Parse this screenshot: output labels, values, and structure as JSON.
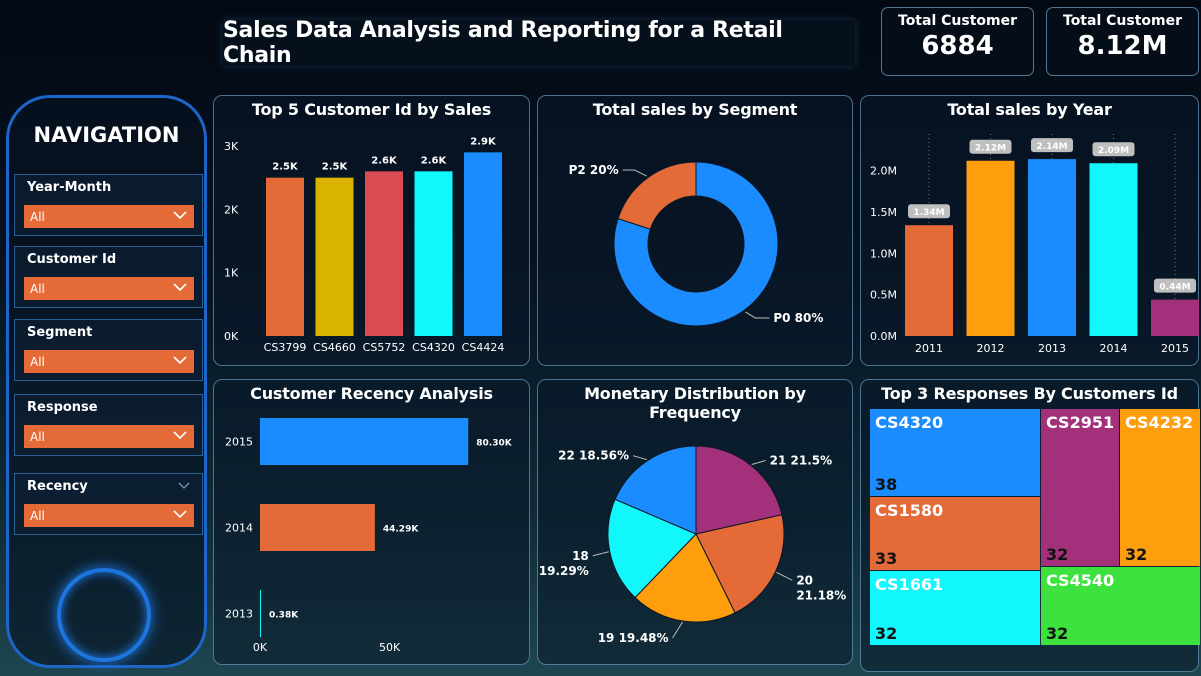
{
  "header": {
    "title": "Sales Data Analysis and Reporting for a Retail Chain"
  },
  "kpis": [
    {
      "label": "Total Customer",
      "value": "6884"
    },
    {
      "label": "Total Customer",
      "value": "8.12M"
    }
  ],
  "nav": {
    "title": "NAVIGATION",
    "filters": [
      {
        "label": "Year-Month",
        "value": "All"
      },
      {
        "label": "Customer Id",
        "value": "All"
      },
      {
        "label": "Segment",
        "value": "All"
      },
      {
        "label": "Response",
        "value": "All"
      },
      {
        "label": "Recency",
        "value": "All"
      }
    ]
  },
  "treemap": {
    "title": "Top 3 Responses By Customers Id",
    "cells": [
      {
        "id": "CS4320",
        "value": "38",
        "color": "#1a8cff"
      },
      {
        "id": "CS1580",
        "value": "33",
        "color": "#e46b38"
      },
      {
        "id": "CS1661",
        "value": "32",
        "color": "#12f7fb"
      },
      {
        "id": "CS2951",
        "value": "32",
        "color": "#a3307a"
      },
      {
        "id": "CS4232",
        "value": "32",
        "color": "#ff9e0d"
      },
      {
        "id": "CS4540",
        "value": "32",
        "color": "#3ee23e"
      }
    ]
  },
  "chart_data": [
    {
      "type": "bar",
      "title": "Top 5 Customer Id by Sales",
      "categories": [
        "CS3799",
        "CS4660",
        "CS5752",
        "CS4320",
        "CS4424"
      ],
      "values": [
        2500,
        2500,
        2600,
        2600,
        2900
      ],
      "data_labels": [
        "2.5K",
        "2.5K",
        "2.6K",
        "2.6K",
        "2.9K"
      ],
      "colors": [
        "#e46b38",
        "#d9b300",
        "#d94a51",
        "#12f7fb",
        "#1a8cff"
      ],
      "yticks": [
        "0K",
        "1K",
        "2K",
        "3K"
      ],
      "ylim": [
        0,
        3000
      ],
      "grid": false
    },
    {
      "type": "pie",
      "title": "Total sales by Segment",
      "labels": [
        "P0",
        "P2"
      ],
      "values": [
        80,
        20
      ],
      "data_labels": [
        "P0 80%",
        "P2 20%"
      ],
      "colors": [
        "#1a8cff",
        "#e46b38"
      ],
      "donut": true
    },
    {
      "type": "bar",
      "title": "Total sales by Year",
      "categories": [
        "2011",
        "2012",
        "2013",
        "2014",
        "2015"
      ],
      "values": [
        1.34,
        2.12,
        2.14,
        2.09,
        0.44
      ],
      "data_labels": [
        "1.34M",
        "2.12M",
        "2.14M",
        "2.09M",
        "0.44M"
      ],
      "colors": [
        "#e46b38",
        "#ff9e0d",
        "#1a8cff",
        "#12f7fb",
        "#a3307a"
      ],
      "yticks": [
        "0.0M",
        "0.5M",
        "1.0M",
        "1.5M",
        "2.0M"
      ],
      "ylim": [
        0,
        2.25
      ]
    },
    {
      "type": "bar",
      "orientation": "horizontal",
      "title": "Customer Recency Analysis",
      "categories": [
        "2015",
        "2014",
        "2013"
      ],
      "values": [
        80.3,
        44.29,
        0.38
      ],
      "data_labels": [
        "80.30K",
        "44.29K",
        "0.38K"
      ],
      "colors": [
        "#1a8cff",
        "#e46b38",
        "#12f7fb"
      ],
      "xticks": [
        "0K",
        "50K"
      ],
      "xlim": [
        0,
        91
      ]
    },
    {
      "type": "pie",
      "title": "Monetary Distribution by Frequency",
      "labels": [
        "21",
        "20",
        "19",
        "18",
        "22"
      ],
      "values": [
        21.5,
        21.18,
        19.48,
        19.29,
        18.56
      ],
      "data_labels": [
        "21 21.5%",
        "20 21.18%",
        "19 19.48%",
        "18 19.29%",
        "22 18.56%"
      ],
      "colors": [
        "#a3307a",
        "#e46b38",
        "#ff9e0d",
        "#12f7fb",
        "#1a8cff"
      ]
    }
  ]
}
